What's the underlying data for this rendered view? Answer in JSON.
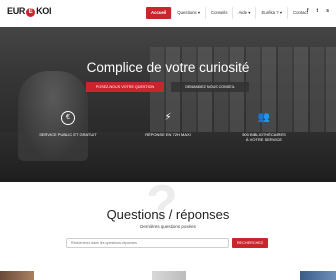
{
  "header": {
    "logo_left": "EUR",
    "logo_mid": "E",
    "logo_right": "KOI",
    "nav": [
      {
        "label": "Accueil",
        "active": true
      },
      {
        "label": "Questions ▾",
        "active": false
      },
      {
        "label": "Conseils",
        "active": false
      },
      {
        "label": "Aide ▾",
        "active": false
      },
      {
        "label": "Eurêka ? ▾",
        "active": false
      },
      {
        "label": "Contact",
        "active": false
      }
    ],
    "social": [
      "f",
      "t",
      "s"
    ]
  },
  "hero": {
    "title": "Complice de votre curiosité",
    "primary_button": "POSEZ-NOUS VOTRE QUESTION",
    "secondary_button": "DEMANDEZ NOUS CONSEIL",
    "features": [
      {
        "icon": "free-euro-icon",
        "glyph": "€",
        "label_1": "SERVICE PUBLIC ET GRATUIT",
        "label_2": ""
      },
      {
        "icon": "lightning-icon",
        "glyph": "⚡",
        "label_1": "RÉPONSE EN 72H MAXI",
        "label_2": ""
      },
      {
        "icon": "people-icon",
        "glyph": "👥",
        "label_1": "500 BIBLIOTHÉCAIRES",
        "label_2": "À VOTRE SERVICE"
      }
    ]
  },
  "qa": {
    "title": "Questions / réponses",
    "subtitle": "Dernières questions posées",
    "search_placeholder": "Recherchez dans les questions-réponses",
    "search_button": "RECHERCHEZ"
  },
  "colors": {
    "accent": "#c9252c",
    "text": "#222222"
  }
}
